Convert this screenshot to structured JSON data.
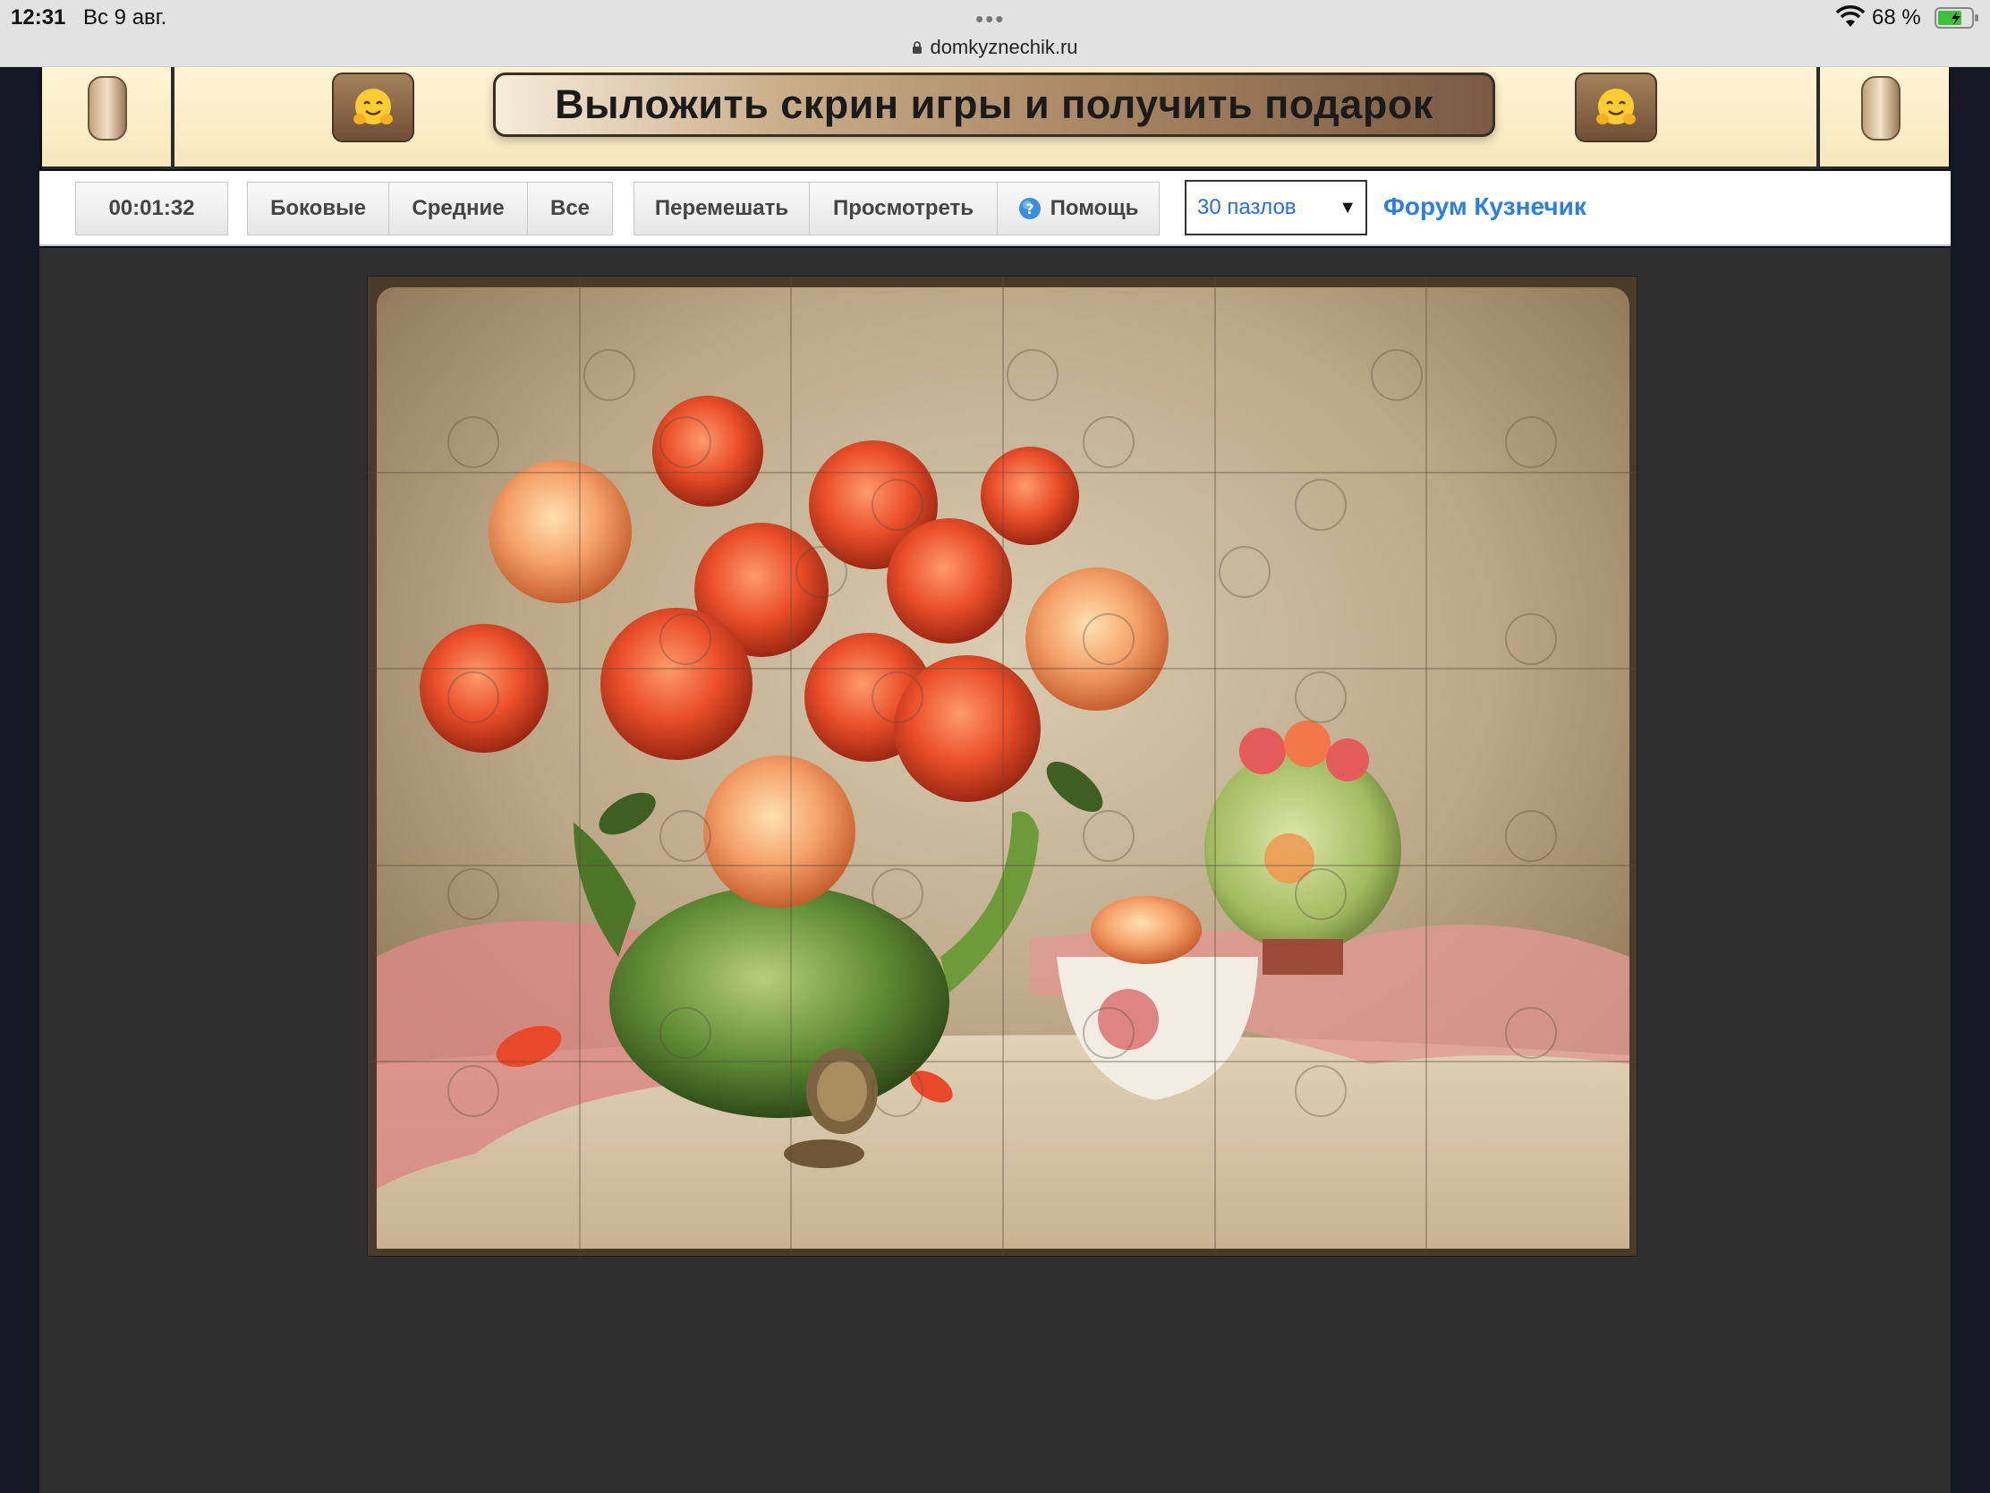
{
  "status_bar": {
    "time": "12:31",
    "date": "Вс 9 авг.",
    "dots": "•••",
    "battery": "68 %",
    "url": "domkyznechik.ru"
  },
  "banner": {
    "text": "Выложить скрин игры и получить подарок",
    "emoji": "🤗"
  },
  "toolbar": {
    "timer": "00:01:32",
    "edge_buttons": [
      "Боковые",
      "Средние",
      "Все"
    ],
    "actions": {
      "shuffle": "Перемешать",
      "preview": "Просмотреть",
      "help": "Помощь"
    },
    "pieces_select": "30 пазлов",
    "forum_link": "Форум Кузнечик"
  },
  "puzzle": {
    "image": "still-life-roses-teapot",
    "grid": {
      "cols": 6,
      "rows": 5
    }
  },
  "colors": {
    "banner_bg": "#f7e7bd",
    "workarea_bg": "#2f2f2f",
    "link": "#2d7ee0"
  }
}
